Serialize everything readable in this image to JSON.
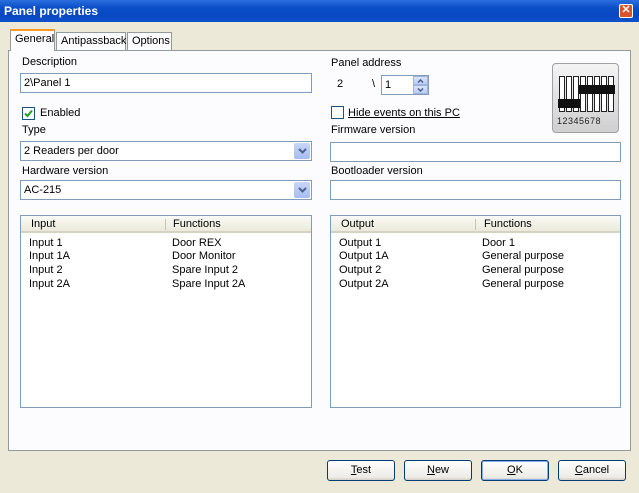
{
  "window": {
    "title": "Panel properties"
  },
  "tabs": [
    "General",
    "Antipassback",
    "Options"
  ],
  "general": {
    "description_label": "Description",
    "description_value": "2\\Panel 1",
    "enabled_label": "Enabled",
    "enabled_checked": true,
    "type_label": "Type",
    "type_value": "2 Readers per door",
    "hardware_label": "Hardware version",
    "hardware_value": "AC-215",
    "panel_address_label": "Panel address",
    "panel_address_prefix": "2",
    "panel_address_sep": "\\",
    "panel_address_value": "1",
    "hide_events_label": "Hide events on this PC",
    "hide_events_checked": false,
    "firmware_label": "Firmware version",
    "firmware_value": "",
    "bootloader_label": "Bootloader version",
    "bootloader_value": "",
    "dip_numbers": "12345678"
  },
  "inputs_table": {
    "columns": [
      "Input",
      "Functions"
    ],
    "rows": [
      [
        "Input 1",
        "Door REX"
      ],
      [
        "Input 1A",
        "Door Monitor"
      ],
      [
        "Input 2",
        "Spare Input 2"
      ],
      [
        "Input 2A",
        "Spare Input 2A"
      ]
    ]
  },
  "outputs_table": {
    "columns": [
      "Output",
      "Functions"
    ],
    "rows": [
      [
        "Output 1",
        "Door 1"
      ],
      [
        "Output 1A",
        "General purpose"
      ],
      [
        "Output 2",
        "General purpose"
      ],
      [
        "Output 2A",
        "General purpose"
      ]
    ]
  },
  "buttons": {
    "test_first": "T",
    "test_rest": "est",
    "new_first": "N",
    "new_rest": "ew",
    "ok_first": "O",
    "ok_rest": "K",
    "cancel_first": "C",
    "cancel_rest": "ancel"
  },
  "colors": {
    "titlebar": "#0a4fc9",
    "active_tab_accent": "#ff9b22",
    "dialog_bg": "#ece9d8",
    "input_border": "#7f9db9"
  },
  "icons": {
    "close": "close-icon",
    "combo_arrow": "chevron-down-icon",
    "checkmark": "checkmark-icon",
    "dip_switch": "dip-switch-icon"
  }
}
